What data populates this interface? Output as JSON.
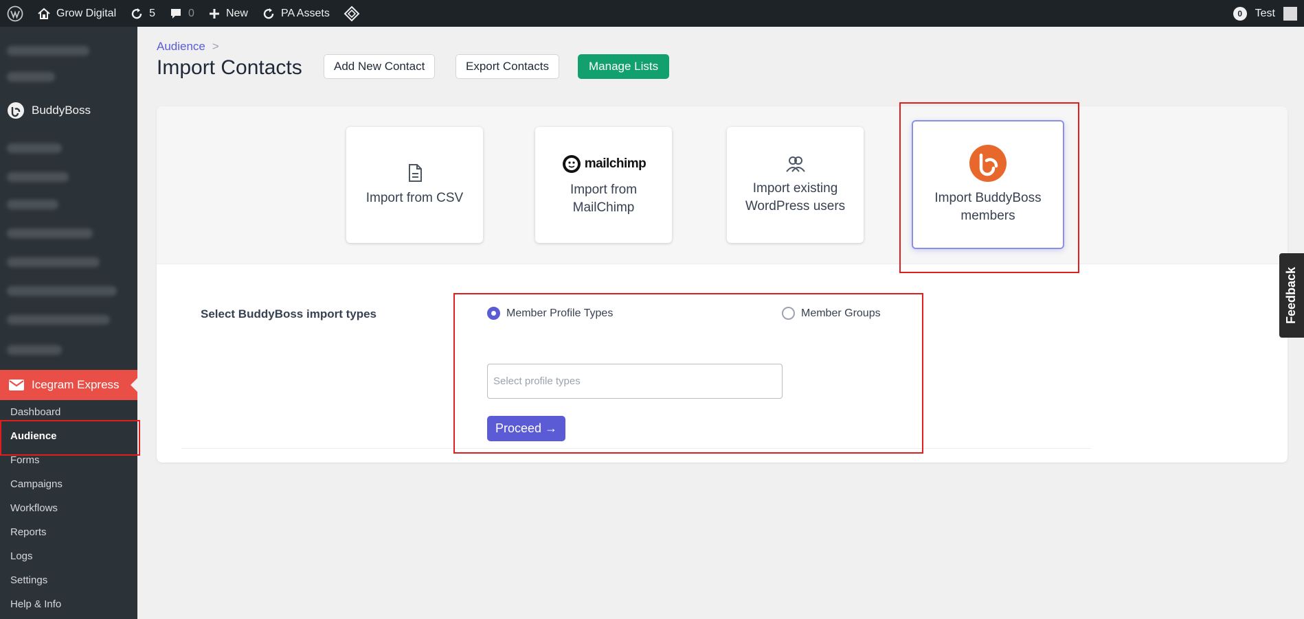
{
  "admin_bar": {
    "site_name": "Grow Digital",
    "updates_count": "5",
    "comments_count": "0",
    "new_label": "New",
    "pa_assets_label": "PA Assets",
    "notification_count": "0",
    "user_name": "Test"
  },
  "sidebar": {
    "buddyboss_label": "BuddyBoss",
    "plugin_label": "Icegram Express",
    "submenu": [
      "Dashboard",
      "Audience",
      "Forms",
      "Campaigns",
      "Workflows",
      "Reports",
      "Logs",
      "Settings",
      "Help & Info"
    ],
    "active_item": "Audience"
  },
  "header": {
    "breadcrumb_parent": "Audience",
    "breadcrumb_separator": ">",
    "title": "Import Contacts",
    "add_contact_label": "Add New Contact",
    "export_contacts_label": "Export Contacts",
    "manage_lists_label": "Manage Lists"
  },
  "import_options": [
    {
      "label": "Import from CSV",
      "icon": "document-icon"
    },
    {
      "label": "Import from MailChimp",
      "icon": "mailchimp-logo",
      "logo_text": "mailchimp"
    },
    {
      "label": "Import existing WordPress users",
      "icon": "users-icon"
    },
    {
      "label": "Import BuddyBoss members",
      "icon": "buddyboss-logo",
      "selected": true
    }
  ],
  "buddyboss_form": {
    "section_label": "Select BuddyBoss import types",
    "option_profile_types": "Member Profile Types",
    "option_groups": "Member Groups",
    "selected_option": "Member Profile Types",
    "profile_types_placeholder": "Select profile types",
    "profile_types_value": "",
    "proceed_label": "Proceed →"
  },
  "feedback_tab": "Feedback",
  "colors": {
    "admin_bar": "#1d2327",
    "sidebar": "#2c3338",
    "plugin_menu": "#e94f47",
    "accent": "#5b5bd6",
    "green_button": "#12a06e",
    "highlight": "#e11d1d",
    "buddyboss_orange": "#e8672a"
  }
}
